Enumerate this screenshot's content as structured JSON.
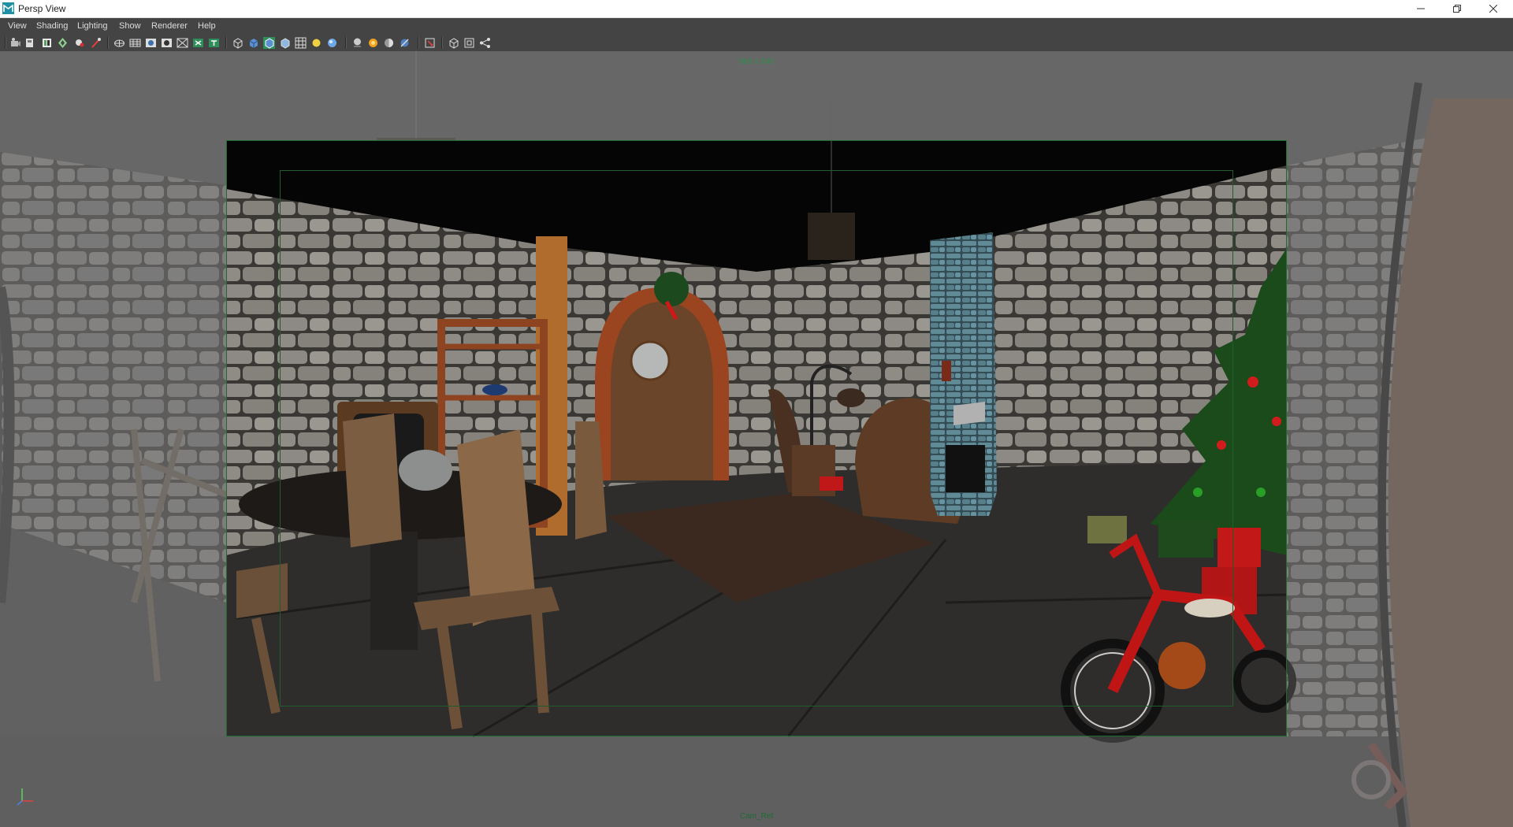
{
  "window": {
    "title": "Persp View",
    "controls": [
      "minimize",
      "restore",
      "close"
    ]
  },
  "menu": {
    "items": [
      "View",
      "Shading",
      "Lighting",
      "Show",
      "Renderer",
      "Help"
    ]
  },
  "toolbar": {
    "groups": [
      [
        "camera-attributes-icon",
        "bookmark-icon",
        "image-plane-icon",
        "2d-pan-zoom-icon",
        "grease-pencil-icon",
        "snap-icon"
      ],
      [
        "grid-icon",
        "film-gate-icon",
        "resolution-gate-icon",
        "gate-mask-icon",
        "field-chart-icon",
        "safe-action-icon",
        "safe-title-icon"
      ],
      [
        "wireframe-icon",
        "smooth-shade-icon",
        "wireframe-on-shaded-icon",
        "textured-icon",
        "default-lighting-icon",
        "shadows-icon",
        "material-icon"
      ],
      [
        "isolate-select-icon",
        "xray-icon",
        "xray-joints-icon",
        "xray-components-icon"
      ],
      [
        "hud-icon",
        "two-side-lighting-icon",
        "viewport-layout-icon",
        "share-icon"
      ]
    ]
  },
  "viewport": {
    "resolution_label": "960 x 540",
    "camera_label": "Cam_Ref",
    "gate_color": "#1b6d2d",
    "label_color": "#2f8f4f"
  }
}
